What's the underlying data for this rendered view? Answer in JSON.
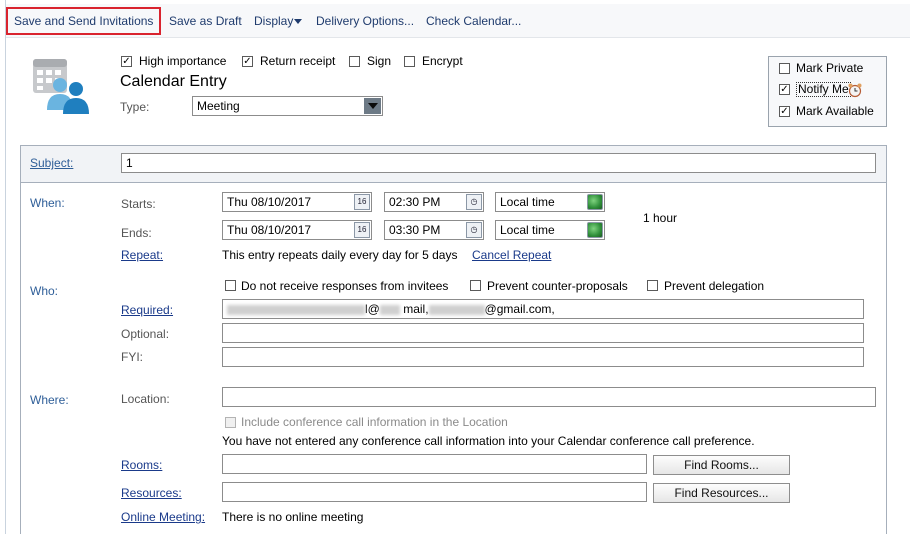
{
  "toolbar": {
    "save_send": "Save and Send Invitations",
    "save_draft": "Save as Draft",
    "display": "Display",
    "delivery": "Delivery Options...",
    "check_calendar": "Check Calendar..."
  },
  "header": {
    "high_importance": "High importance",
    "return_receipt": "Return receipt",
    "sign": "Sign",
    "encrypt": "Encrypt",
    "title": "Calendar Entry",
    "type_label": "Type:",
    "type_value": "Meeting"
  },
  "options": {
    "mark_private": "Mark Private",
    "notify_me": "Notify Me",
    "mark_available": "Mark Available"
  },
  "subject": {
    "label": "Subject:",
    "value": "1"
  },
  "when": {
    "section": "When:",
    "starts_label": "Starts:",
    "start_date": "Thu 08/10/2017",
    "start_time": "02:30 PM",
    "start_tz": "Local time",
    "ends_label": "Ends:",
    "end_date": "Thu 08/10/2017",
    "end_time": "03:30 PM",
    "end_tz": "Local time",
    "duration": "1 hour",
    "date_btn": "16",
    "repeat_label": "Repeat:",
    "repeat_text": "This entry repeats daily every day for 5 days",
    "cancel_repeat": "Cancel Repeat"
  },
  "who": {
    "section": "Who:",
    "no_responses": "Do not receive responses from invitees",
    "prevent_counter": "Prevent counter-proposals",
    "prevent_delegation": "Prevent delegation",
    "required_label": "Required:",
    "required_value_a": "l@",
    "required_value_b": "mail,",
    "required_value_c": "@gmail.com,",
    "optional_label": "Optional:",
    "fyi_label": "FYI:"
  },
  "where": {
    "section": "Where:",
    "location_label": "Location:",
    "include_conf": "Include conference call information in the Location",
    "conf_note": "You have not entered any conference call information into your Calendar conference call preference.",
    "rooms_label": "Rooms:",
    "find_rooms": "Find Rooms...",
    "resources_label": "Resources:",
    "find_resources": "Find Resources...",
    "online_label": "Online Meeting:",
    "online_value": "There is no online meeting"
  },
  "colors": {
    "highlight": "#d9232e",
    "link": "#1a3a8a",
    "section": "#2e5e98"
  }
}
